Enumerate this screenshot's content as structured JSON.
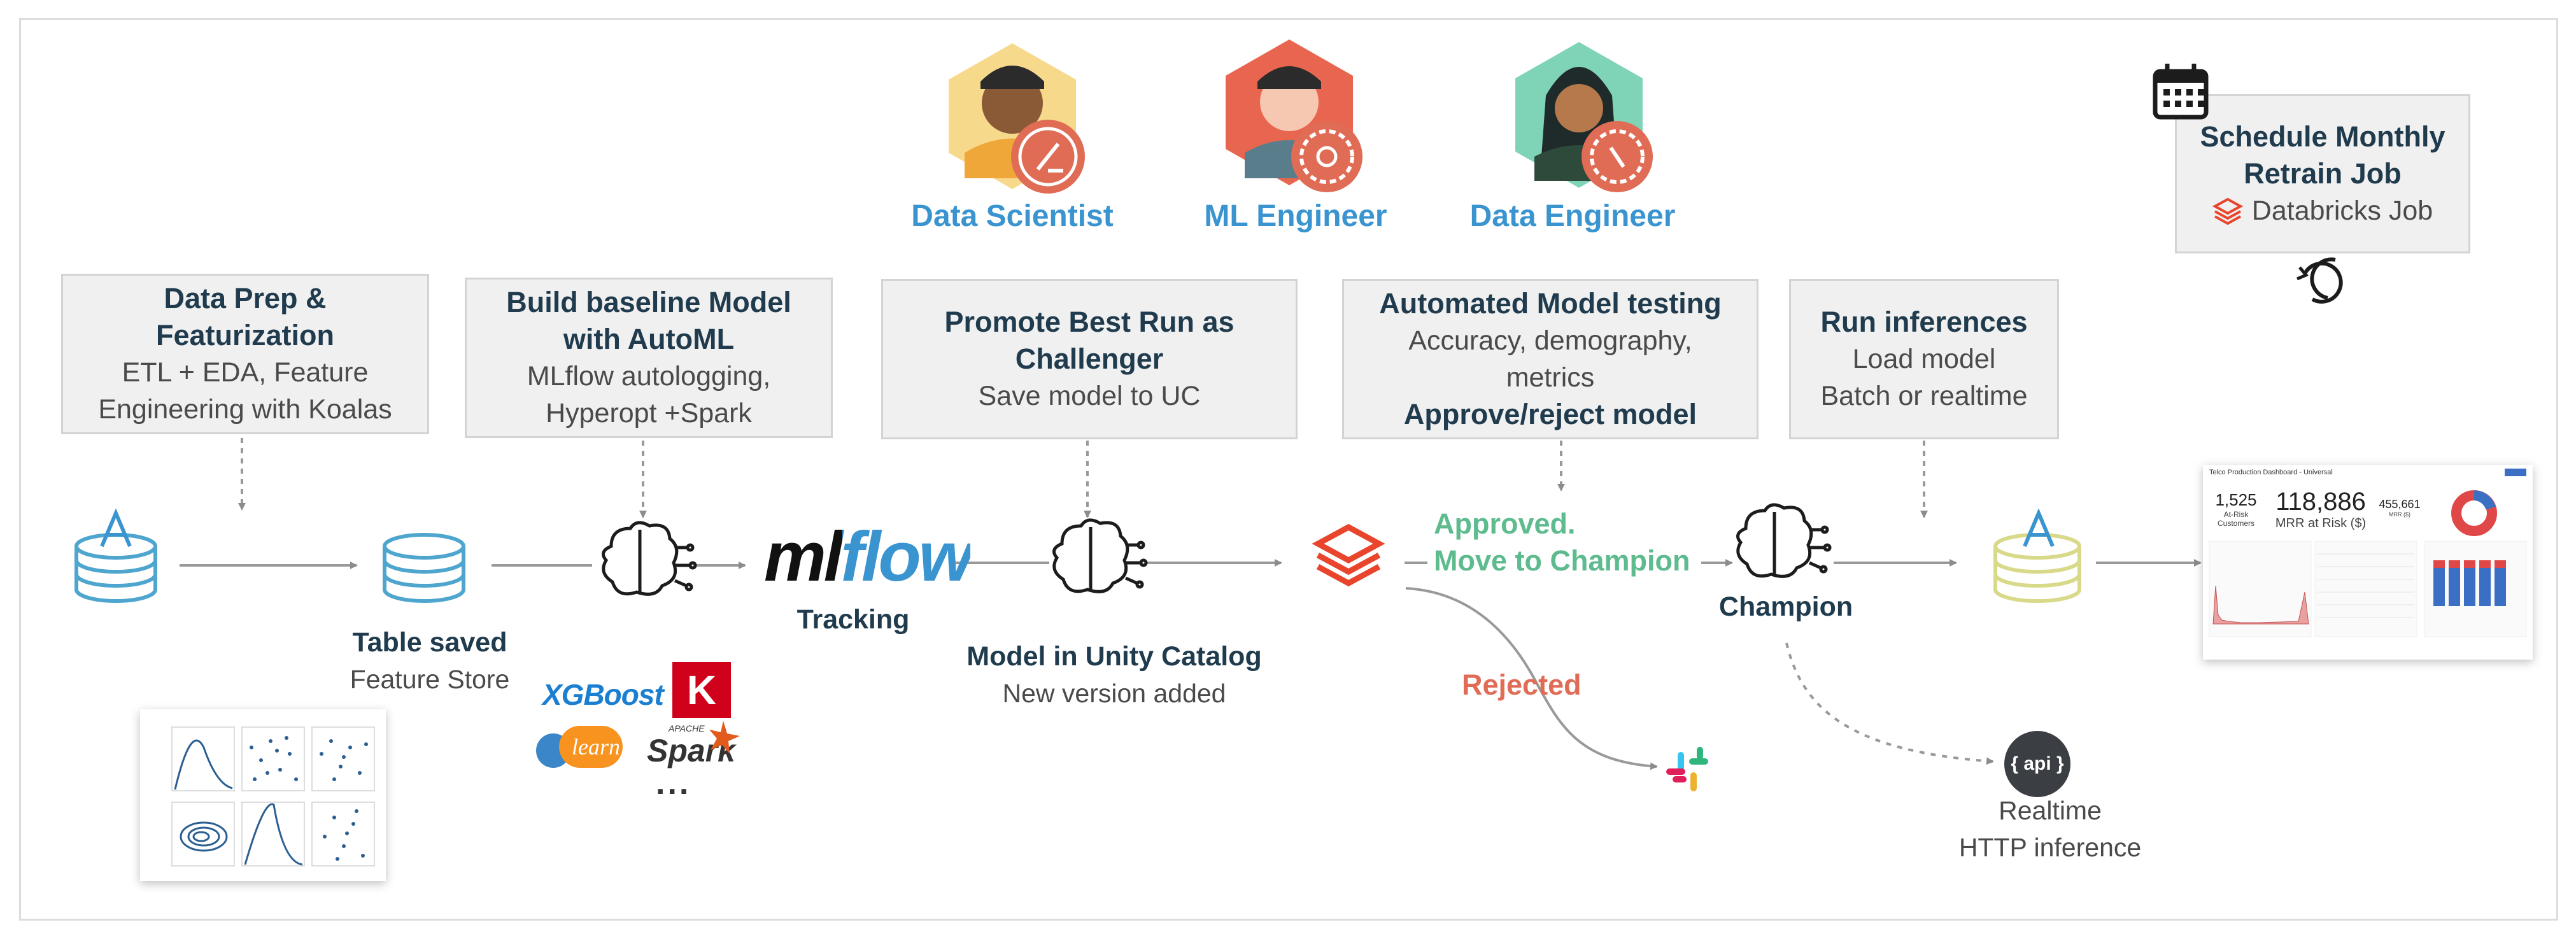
{
  "roles": {
    "data_scientist": "Data Scientist",
    "ml_engineer": "ML Engineer",
    "data_engineer": "Data Engineer"
  },
  "steps": {
    "prep": {
      "title": "Data Prep &\nFeaturization",
      "sub": "ETL + EDA, Feature\nEngineering with Koalas"
    },
    "baseline": {
      "title": "Build baseline Model\nwith AutoML",
      "sub": "MLflow autologging,\nHyperopt +Spark"
    },
    "promote": {
      "title": "Promote Best Run as\nChallenger",
      "sub": "Save model to UC"
    },
    "testing": {
      "title": "Automated Model testing",
      "sub": "Accuracy, demography,\nmetrics",
      "bold": "Approve/reject model"
    },
    "inference": {
      "title": "Run inferences",
      "sub": "Load model\nBatch or realtime"
    },
    "schedule": {
      "title": "Schedule Monthly\nRetrain Job",
      "sub": "Databricks Job"
    }
  },
  "labels": {
    "table_saved": "Table saved",
    "feature_store": "Feature Store",
    "tracking": "Tracking",
    "mlflow_logo": "mlflow",
    "uc_title": "Model in Unity Catalog",
    "uc_sub": "New version added",
    "approved": "Approved.\nMove to Champion",
    "rejected": "Rejected",
    "champion": "Champion",
    "api": "{ api }",
    "realtime": "Realtime",
    "http_inference": "HTTP inference",
    "xgboost": "XGBoost",
    "keras": "K",
    "sklearn": "learn",
    "spark": "Spark",
    "apache": "APACHE",
    "more": "..."
  },
  "dashboard": {
    "title": "Telco Production Dashboard - Universal",
    "kpi1_value": "1,525",
    "kpi1_label": "At-Risk\nCustomers",
    "kpi2_value": "118,886",
    "kpi2_label": "MRR at Risk ($)",
    "kpi3_value": "455,661",
    "kpi3_label": "MRR ($)"
  },
  "colors": {
    "accent_blue": "#3a94cf",
    "approved_green": "#5dbb8e",
    "rejected_red": "#e06c55",
    "databricks_red": "#e8452c",
    "box_bg": "#f0f0f0"
  }
}
